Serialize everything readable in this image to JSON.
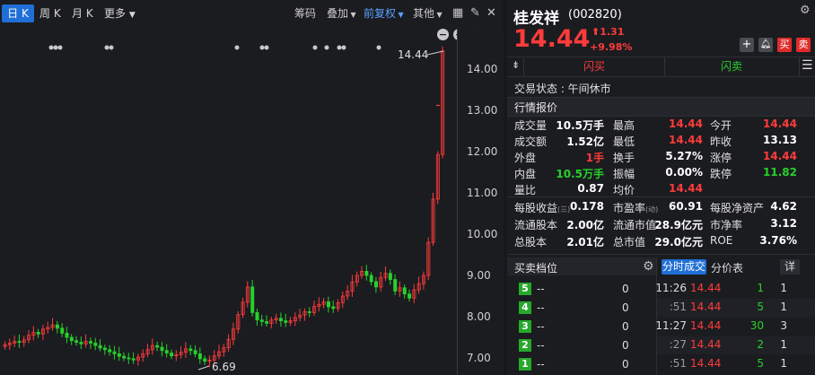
{
  "toolbar": {
    "tabs": [
      "日 K",
      "周 K",
      "月 K",
      "更多"
    ],
    "right": [
      "筹码",
      "叠加",
      "前复权",
      "其他"
    ]
  },
  "chart": {
    "y_ticks": [
      "14.00",
      "13.00",
      "12.00",
      "11.00",
      "10.00",
      "9.00",
      "8.00",
      "7.00"
    ],
    "high_marker": "14.44",
    "low_marker": "6.69"
  },
  "stock": {
    "name": "桂发祥",
    "code": "(002820)",
    "price": "14.44",
    "change": "1.31",
    "change_pct": "+9.98%",
    "buy_label": "买",
    "sell_label": "卖"
  },
  "flash": {
    "buy": "闪买",
    "sell": "闪卖"
  },
  "trade_status": "交易状态 : 午间休市",
  "quote_title": "行情报价",
  "quote_rows": [
    [
      {
        "l": "成交量",
        "v": "10.5万手",
        "c": "w"
      },
      {
        "l": "最高",
        "v": "14.44",
        "c": "r"
      },
      {
        "l": "今开",
        "v": "14.44",
        "c": "r"
      }
    ],
    [
      {
        "l": "成交额",
        "v": "1.52亿",
        "c": "w"
      },
      {
        "l": "最低",
        "v": "14.44",
        "c": "r"
      },
      {
        "l": "昨收",
        "v": "13.13",
        "c": "w"
      }
    ],
    [
      {
        "l": "外盘",
        "v": "1手",
        "c": "r"
      },
      {
        "l": "换手",
        "v": "5.27%",
        "c": "w"
      },
      {
        "l": "涨停",
        "v": "14.44",
        "c": "r"
      }
    ],
    [
      {
        "l": "内盘",
        "v": "10.5万手",
        "c": "g"
      },
      {
        "l": "振幅",
        "v": "0.00%",
        "c": "w"
      },
      {
        "l": "跌停",
        "v": "11.82",
        "c": "g"
      }
    ],
    [
      {
        "l": "量比",
        "v": "0.87",
        "c": "w"
      },
      {
        "l": "均价",
        "v": "14.44",
        "c": "r"
      }
    ]
  ],
  "fund_rows": [
    [
      {
        "l": "每股收益",
        "sub": "(三)",
        "v": "0.178"
      },
      {
        "l": "市盈率",
        "sub": "(动)",
        "v": "60.91"
      },
      {
        "l": "每股净资产",
        "v": "4.62"
      }
    ],
    [
      {
        "l": "流通股本",
        "v": "2.00亿"
      },
      {
        "l": "流通市值",
        "v": "28.9亿元"
      },
      {
        "l": "市净率",
        "v": "3.12"
      }
    ],
    [
      {
        "l": "总股本",
        "v": "2.01亿"
      },
      {
        "l": "总市值",
        "v": "29.0亿元"
      },
      {
        "l": "ROE",
        "v": "3.76%"
      }
    ]
  ],
  "orderbook": {
    "title": "买卖档位",
    "levels": [
      {
        "n": "5",
        "p": "--",
        "q": "0"
      },
      {
        "n": "4",
        "p": "--",
        "q": "0"
      },
      {
        "n": "3",
        "p": "--",
        "q": "0"
      },
      {
        "n": "2",
        "p": "--",
        "q": "0"
      },
      {
        "n": "1",
        "p": "--",
        "q": "0"
      }
    ]
  },
  "ticks_tabs": [
    "分时成交",
    "分价表",
    "详"
  ],
  "ticks": [
    {
      "t": "11:26",
      "p": "14.44",
      "v": "1",
      "vc": "g",
      "n": "1"
    },
    {
      "t": ":51",
      "p": "14.44",
      "v": "5",
      "vc": "g",
      "n": "1"
    },
    {
      "t": "11:27",
      "p": "14.44",
      "v": "30",
      "vc": "g",
      "n": "3"
    },
    {
      "t": ":27",
      "p": "14.44",
      "v": "2",
      "vc": "g",
      "n": "1"
    },
    {
      "t": ":51",
      "p": "14.44",
      "v": "5",
      "vc": "g",
      "n": "1"
    }
  ]
}
